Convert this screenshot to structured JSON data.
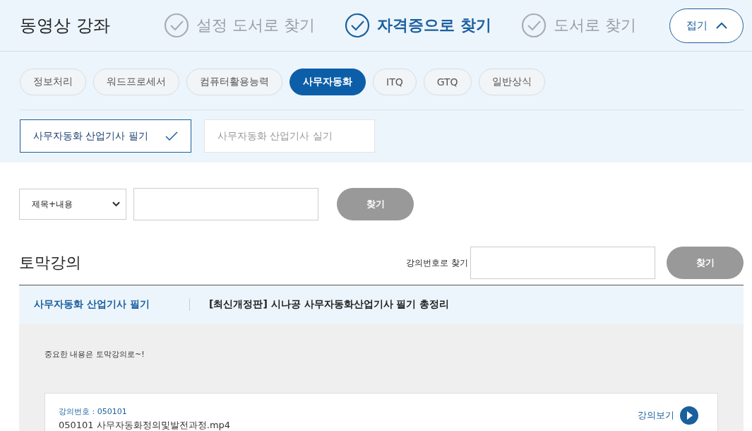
{
  "page_title": "동영상 강좌",
  "steps": [
    {
      "label": "설정 도서로 찾기",
      "selected": false
    },
    {
      "label": "자격증으로 찾기",
      "selected": true
    },
    {
      "label": "도서로 찾기",
      "selected": false
    }
  ],
  "collapse_button": "접기",
  "categories": [
    {
      "label": "정보처리",
      "selected": false
    },
    {
      "label": "워드프로세서",
      "selected": false
    },
    {
      "label": "컴퓨터활용능력",
      "selected": false
    },
    {
      "label": "사무자동화",
      "selected": true
    },
    {
      "label": "ITQ",
      "selected": false
    },
    {
      "label": "GTQ",
      "selected": false
    },
    {
      "label": "일반상식",
      "selected": false
    }
  ],
  "subcategories": [
    {
      "label": "사무자동화 산업기사 필기",
      "selected": true
    },
    {
      "label": "사무자동화 산업기사 실기",
      "selected": false
    }
  ],
  "search": {
    "select_value": "제목+내용",
    "button": "찾기"
  },
  "section": {
    "title": "토막강의",
    "number_search_label": "강의번호로 찾기",
    "button": "찾기"
  },
  "lecture": {
    "category": "사무자동화 산업기사 필기",
    "title": "[최신개정판] 시나공 사무자동화산업기사 필기 총정리",
    "description": "중요한 내용은 토막강의로~!",
    "video": {
      "number_label": "강의번호 : 050101",
      "file": "050101 사무자동화정의및발전과정.mp4",
      "play": "강의보기"
    }
  }
}
